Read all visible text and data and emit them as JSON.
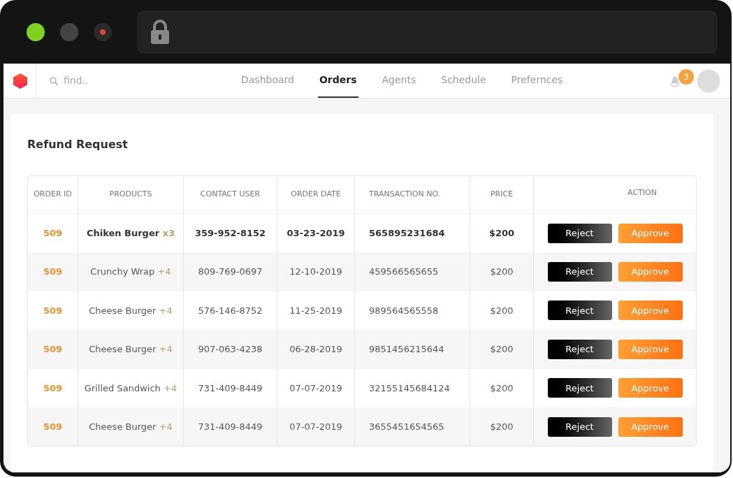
{
  "nav": {
    "search": {
      "placeholder": "find.."
    },
    "tabs": [
      {
        "label": "Dashboard",
        "selected": false
      },
      {
        "label": "Orders",
        "selected": true
      },
      {
        "label": "Agents",
        "selected": false
      },
      {
        "label": "Schedule",
        "selected": false
      },
      {
        "label": "Prefernces",
        "selected": false
      }
    ],
    "notifications": {
      "count": "3"
    }
  },
  "card": {
    "title": "Refund Request"
  },
  "table": {
    "columns": [
      "ORDER ID",
      "PRODUCTS",
      "CONTACT USER",
      "ORDER DATE",
      "TRANSACTION NO.",
      "PRICE",
      "ACTION"
    ],
    "rows": [
      {
        "order_id": "509",
        "product": "Chiken Burger",
        "quantity": "x3",
        "contact": "359-952-8152",
        "date": "03-23-2019",
        "transaction": "565895231684",
        "price": "$200",
        "highlighted": true,
        "reject": "Reject",
        "approve": "Approve"
      },
      {
        "order_id": "509",
        "product": "Crunchy Wrap",
        "quantity": "+4",
        "contact": "809-769-0697",
        "date": "12-10-2019",
        "transaction": "459566565655",
        "price": "$200",
        "highlighted": false,
        "reject": "Reject",
        "approve": "Approve"
      },
      {
        "order_id": "509",
        "product": "Cheese Burger",
        "quantity": "+4",
        "contact": "576-146-8752",
        "date": "11-25-2019",
        "transaction": "989564565558",
        "price": "$200",
        "highlighted": false,
        "reject": "Reject",
        "approve": "Approve"
      },
      {
        "order_id": "509",
        "product": "Cheese Burger",
        "quantity": "+4",
        "contact": "907-063-4238",
        "date": "06-28-2019",
        "transaction": "9851456215644",
        "price": "$200",
        "highlighted": false,
        "reject": "Reject",
        "approve": "Approve"
      },
      {
        "order_id": "509",
        "product": "Grilled Sandwich",
        "quantity": "+4",
        "contact": "731-409-8449",
        "date": "07-07-2019",
        "transaction": "32155145684124",
        "price": "$200",
        "highlighted": false,
        "reject": "Reject",
        "approve": "Approve"
      },
      {
        "order_id": "509",
        "product": "Cheese Burger",
        "quantity": "+4",
        "contact": "731-409-8449",
        "date": "07-07-2019",
        "transaction": "3655451654565",
        "price": "$200",
        "highlighted": false,
        "reject": "Reject",
        "approve": "Approve"
      }
    ]
  }
}
